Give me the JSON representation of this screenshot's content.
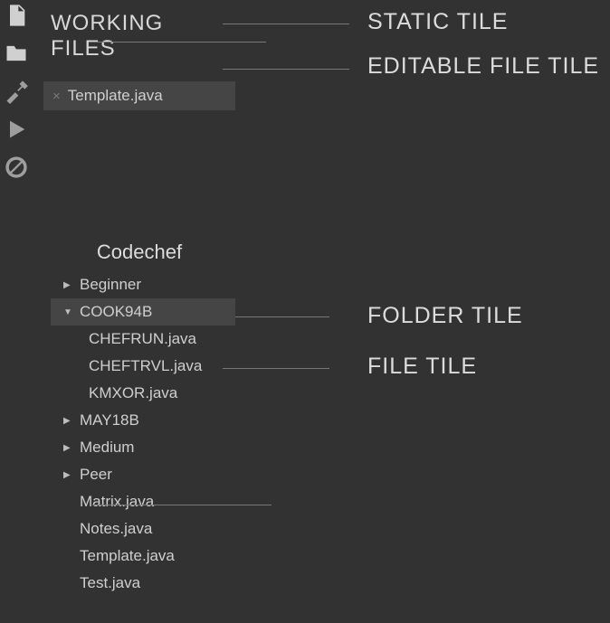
{
  "sidebar": {
    "workingHeader": "WORKING FILES",
    "workingItem": "Template.java",
    "projectTitle": "Codechef",
    "tree": {
      "beginner": "Beginner",
      "cook94b": "COOK94B",
      "chefrun": "CHEFRUN.java",
      "cheftrvl": "CHEFTRVL.java",
      "kmxor": "KMXOR.java",
      "may18b": "MAY18B",
      "medium": "Medium",
      "peer": "Peer",
      "matrix": "Matrix.java",
      "notes": "Notes.java",
      "template": "Template.java",
      "test": "Test.java"
    }
  },
  "labels": {
    "staticTile": "STATIC TILE",
    "editableTile": "EDITABLE FILE TILE",
    "folderTile": "FOLDER TILE",
    "fileTile": "FILE TILE"
  },
  "icons": {
    "file": "file-icon",
    "folder": "folder-icon",
    "hammer": "hammer-icon",
    "play": "play-icon",
    "block": "block-icon"
  }
}
